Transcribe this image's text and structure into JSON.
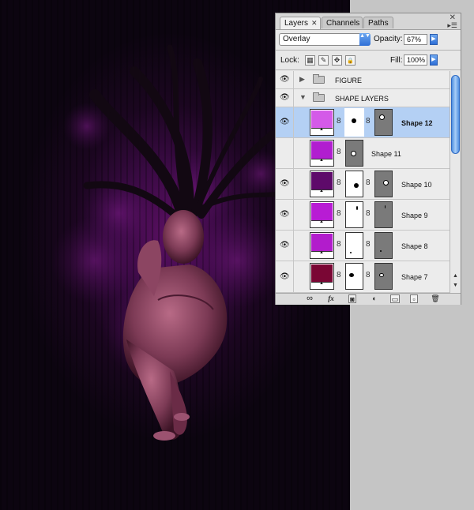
{
  "panel": {
    "tabs": [
      {
        "label": "Layers",
        "close": "✕"
      },
      {
        "label": "Channels"
      },
      {
        "label": "Paths"
      }
    ],
    "close_glyph": "✕",
    "menu_glyph": "▸☰",
    "blend_mode": "Overlay",
    "opacity_label": "Opacity:",
    "opacity_value": "67%",
    "lock_label": "Lock:",
    "fill_label": "Fill:",
    "fill_value": "100%",
    "groups": [
      {
        "name": "FIGURE",
        "expanded": false
      },
      {
        "name": "SHAPE LAYERS",
        "expanded": true
      }
    ],
    "layers": [
      {
        "name": "Shape 12",
        "color": "#d45ae8",
        "selected": true
      },
      {
        "name": "Shape 11",
        "color": "#b11ed0",
        "selected": false
      },
      {
        "name": "Shape 10",
        "color": "#5e0a6a",
        "selected": false
      },
      {
        "name": "Shape 9",
        "color": "#b81cd4",
        "selected": false
      },
      {
        "name": "Shape 8",
        "color": "#b21ccc",
        "selected": false
      },
      {
        "name": "Shape 7",
        "color": "#7a0634",
        "selected": false
      }
    ],
    "toolbar": {
      "link": "∞",
      "fx": "fx",
      "mask": "◙",
      "adjust": "◐",
      "group": "▭",
      "new": "▫",
      "delete": "🗑"
    }
  },
  "icons": {
    "eye": "👁",
    "chain": "8",
    "lock_transparent": "▦",
    "lock_paint": "✎",
    "lock_move": "✥",
    "lock_all": "🔒",
    "dropdown": "▲▼",
    "arrow_right": "▶",
    "expand_closed": "▶",
    "expand_open": "▼",
    "scroll_up": "▲",
    "scroll_down": "▼"
  }
}
